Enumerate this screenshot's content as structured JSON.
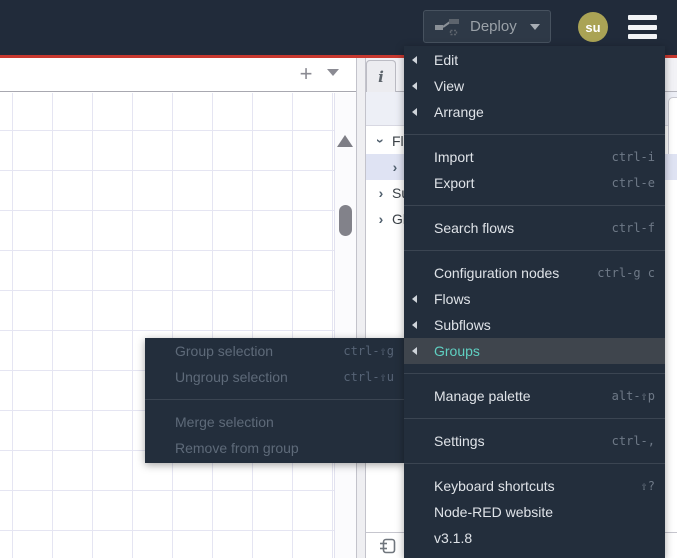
{
  "header": {
    "deploy_label": "Deploy",
    "user_initials": "su"
  },
  "workspace_toolbar": {
    "add_flow_label": "+"
  },
  "sidebar": {
    "tabs": [
      {
        "label": "i",
        "active": true
      },
      {
        "label": "i"
      }
    ],
    "tree": [
      {
        "chevron": "down",
        "label": "Flo"
      },
      {
        "chevron": "right",
        "label": "",
        "selected": true,
        "indent": true
      },
      {
        "chevron": "right",
        "label": "Su"
      },
      {
        "chevron": "right",
        "label": "Glo"
      }
    ]
  },
  "main_menu": {
    "items": [
      {
        "label": "Edit",
        "submenu": true
      },
      {
        "label": "View",
        "submenu": true
      },
      {
        "label": "Arrange",
        "submenu": true
      },
      {
        "type": "separator"
      },
      {
        "label": "Import",
        "shortcut": "ctrl-i"
      },
      {
        "label": "Export",
        "shortcut": "ctrl-e"
      },
      {
        "type": "separator"
      },
      {
        "label": "Search flows",
        "shortcut": "ctrl-f"
      },
      {
        "type": "separator"
      },
      {
        "label": "Configuration nodes",
        "shortcut": "ctrl-g c"
      },
      {
        "label": "Flows",
        "submenu": true
      },
      {
        "label": "Subflows",
        "submenu": true
      },
      {
        "label": "Groups",
        "submenu": true,
        "active": true
      },
      {
        "type": "separator"
      },
      {
        "label": "Manage palette",
        "shortcut": "alt-⇧p"
      },
      {
        "type": "separator"
      },
      {
        "label": "Settings",
        "shortcut": "ctrl-,"
      },
      {
        "type": "separator"
      },
      {
        "label": "Keyboard shortcuts",
        "shortcut": "⇧?"
      },
      {
        "label": "Node-RED website"
      },
      {
        "label": "v3.1.8"
      }
    ]
  },
  "groups_submenu": {
    "items": [
      {
        "label": "Group selection",
        "shortcut": "ctrl-⇧g",
        "disabled": true
      },
      {
        "label": "Ungroup selection",
        "shortcut": "ctrl-⇧u",
        "disabled": true
      },
      {
        "type": "separator"
      },
      {
        "label": "Merge selection",
        "disabled": true
      },
      {
        "label": "Remove from group",
        "disabled": true
      }
    ]
  },
  "colors": {
    "header_bg": "#212b3a",
    "accent_red": "#c8382f",
    "menu_bg": "#232e3c",
    "menu_highlight_bg": "#3f454d",
    "menu_highlight_text": "#5fd0c2",
    "user_badge_bg": "#aaa355",
    "selected_tree_row_bg": "#dfe3f3"
  }
}
